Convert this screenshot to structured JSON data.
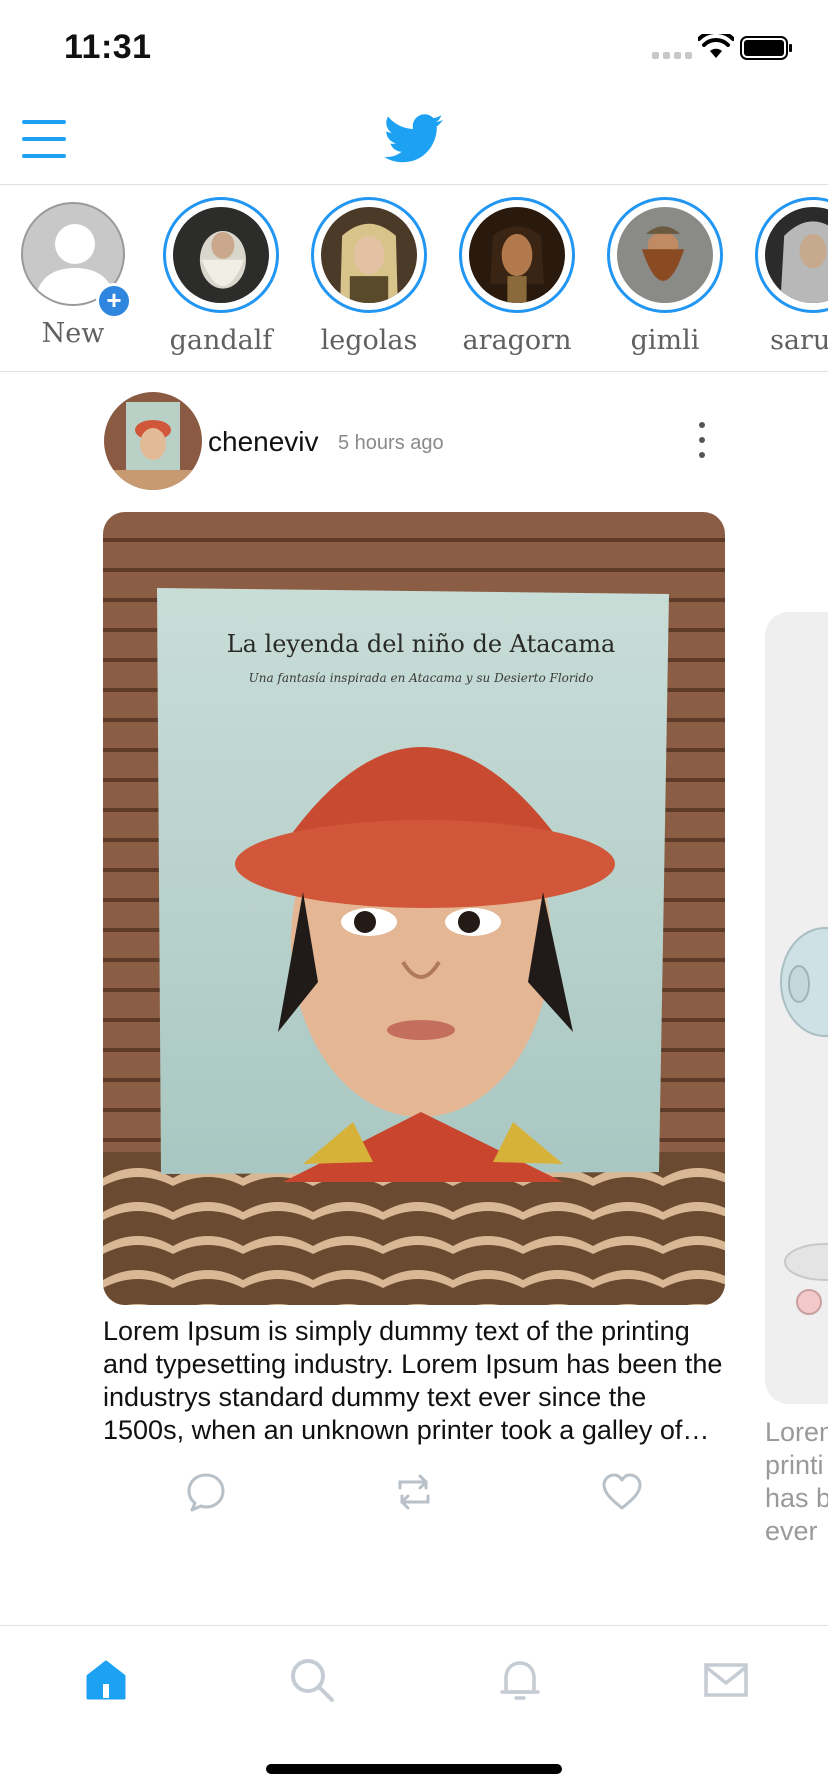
{
  "status_bar": {
    "time": "11:31"
  },
  "header": {
    "logo_icon": "twitter-bird-icon",
    "menu_icon": "hamburger-menu-icon"
  },
  "stories": [
    {
      "label": "New",
      "kind": "new"
    },
    {
      "label": "gandalf"
    },
    {
      "label": "legolas"
    },
    {
      "label": "aragorn"
    },
    {
      "label": "gimli"
    },
    {
      "label": "sarum"
    }
  ],
  "post": {
    "username": "cheneviv",
    "time_ago": "5 hours ago",
    "image": {
      "book_title": "La leyenda del niño de Atacama",
      "book_subtitle": "Una fantasía inspirada en Atacama y su Desierto Florido"
    },
    "text": "Lorem Ipsum is simply dummy text of the printing and typesetting industry. Lorem Ipsum has been the industrys standard dummy text ever since the 1500s, when an unknown printer took a galley of type and scrambled it to make a type specimen book.",
    "actions": [
      "comment-icon",
      "retweet-icon",
      "like-icon"
    ]
  },
  "next_post": {
    "text_lines": [
      "Lorem",
      "printi",
      "has b",
      "ever"
    ]
  },
  "tab_bar": {
    "tabs": [
      "home-icon",
      "search-icon",
      "notifications-icon",
      "messages-icon"
    ],
    "active": "home-icon"
  },
  "colors": {
    "accent": "#1da1f2",
    "story_ring": "#2196f3",
    "muted_text": "#606060"
  }
}
